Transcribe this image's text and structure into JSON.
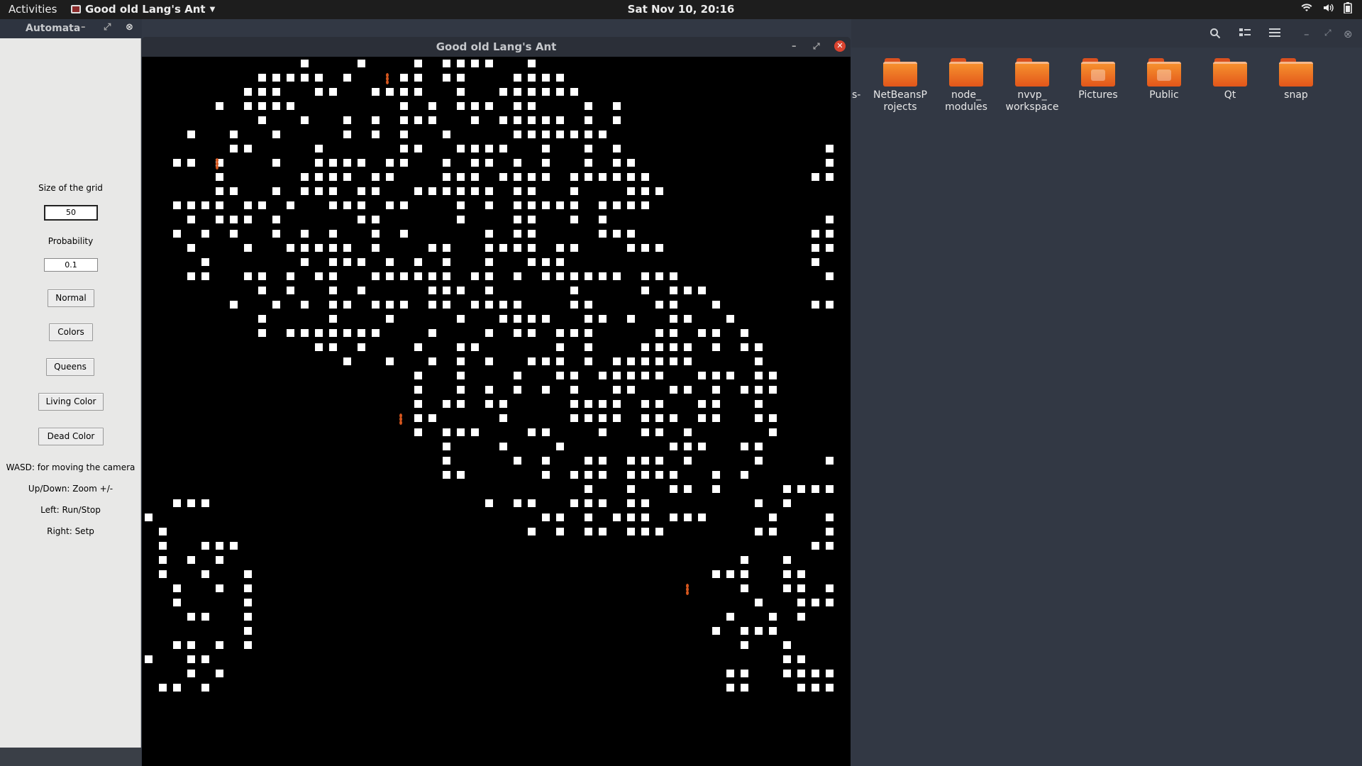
{
  "topbar": {
    "activities": "Activities",
    "app_name": "Good old Lang's Ant",
    "clock": "Sat Nov 10, 20:16",
    "tray_icons": [
      "wifi-icon",
      "volume-icon",
      "battery-icon"
    ]
  },
  "automata_window": {
    "title": "Automata",
    "grid_size_label": "Size of the grid",
    "grid_size_value": "50",
    "probability_label": "Probability",
    "probability_value": "0.1",
    "buttons": {
      "normal": "Normal",
      "colors": "Colors",
      "queens": "Queens",
      "living_color": "Living Color",
      "dead_color": "Dead Color"
    },
    "help": {
      "wasd": "WASD: for moving the camera",
      "zoom": "Up/Down: Zoom +/-",
      "run": "Left: Run/Stop",
      "step": "Right: Setp"
    }
  },
  "ant_window": {
    "title": "Good old Lang's Ant",
    "colors": {
      "background": "#000000",
      "cell": "#ffffff",
      "ant": "#d4561e"
    }
  },
  "file_manager": {
    "partial_label": "s-",
    "folders": [
      {
        "label": "NetBeansP\nrojects",
        "icon": "folder-icon"
      },
      {
        "label": "node_\nmodules",
        "icon": "folder-icon"
      },
      {
        "label": "nvvp_\nworkspace",
        "icon": "folder-icon"
      },
      {
        "label": "Pictures",
        "icon": "folder-pictures-icon"
      },
      {
        "label": "Public",
        "icon": "folder-public-icon"
      },
      {
        "label": "Qt",
        "icon": "folder-icon"
      },
      {
        "label": "snap",
        "icon": "folder-icon"
      }
    ]
  }
}
